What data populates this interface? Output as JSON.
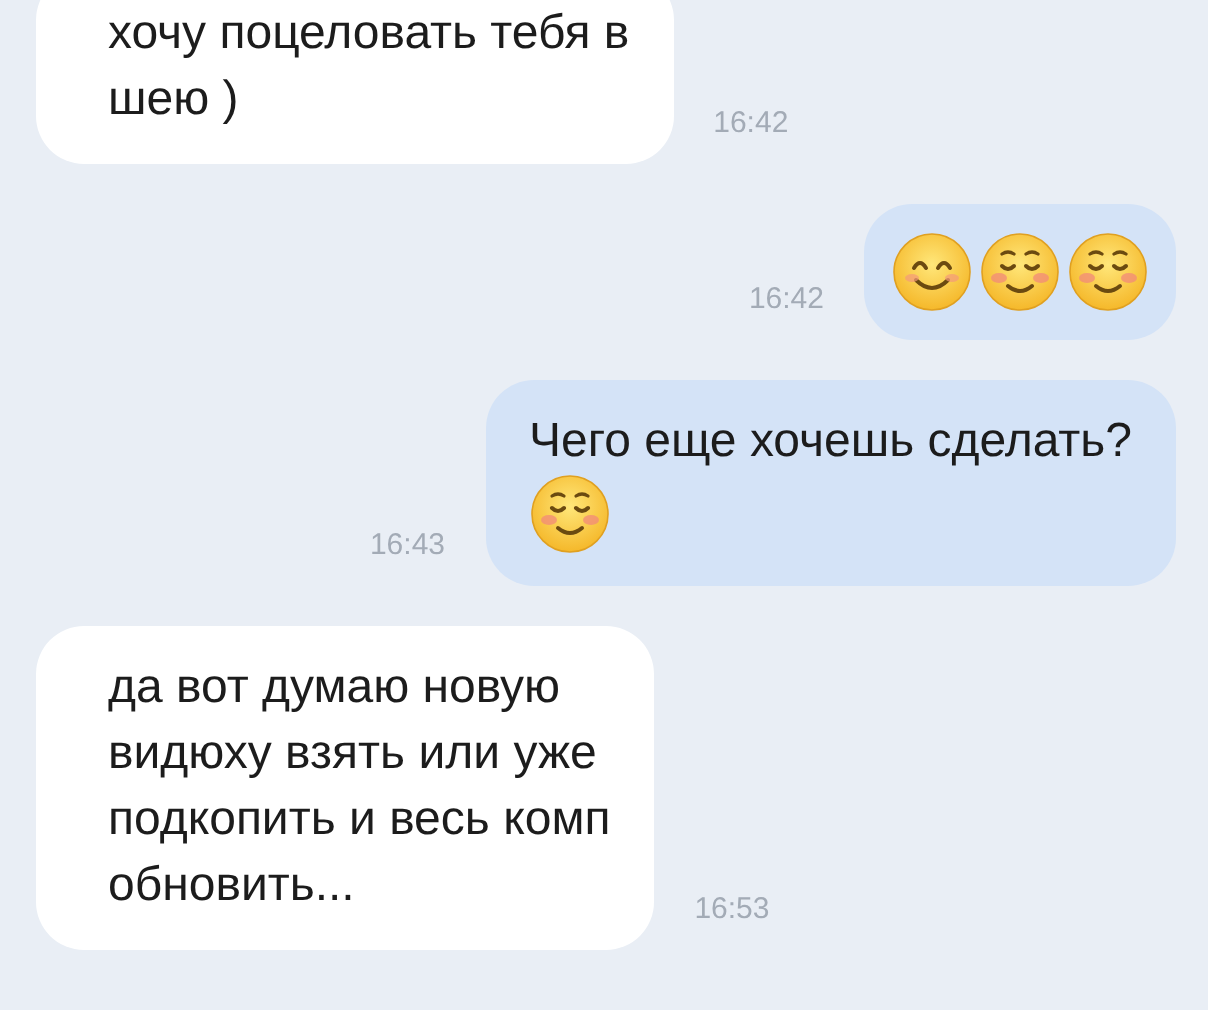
{
  "messages": [
    {
      "kind": "incoming",
      "text": "хочу поцеловать тебя в\nшею )",
      "time": "16:42"
    },
    {
      "kind": "outgoing",
      "emoji": [
        {
          "kind": "smile"
        },
        {
          "kind": "blush"
        },
        {
          "kind": "blush"
        }
      ],
      "time": "16:42"
    },
    {
      "kind": "outgoing",
      "text": "Чего еще хочешь сделать?",
      "emoji": [
        {
          "kind": "blush"
        }
      ],
      "time": "16:43"
    },
    {
      "kind": "incoming",
      "text": "да вот думаю новую\nвидюху взять или уже\nподкопить и весь комп\nобновить...",
      "time": "16:53"
    }
  ]
}
